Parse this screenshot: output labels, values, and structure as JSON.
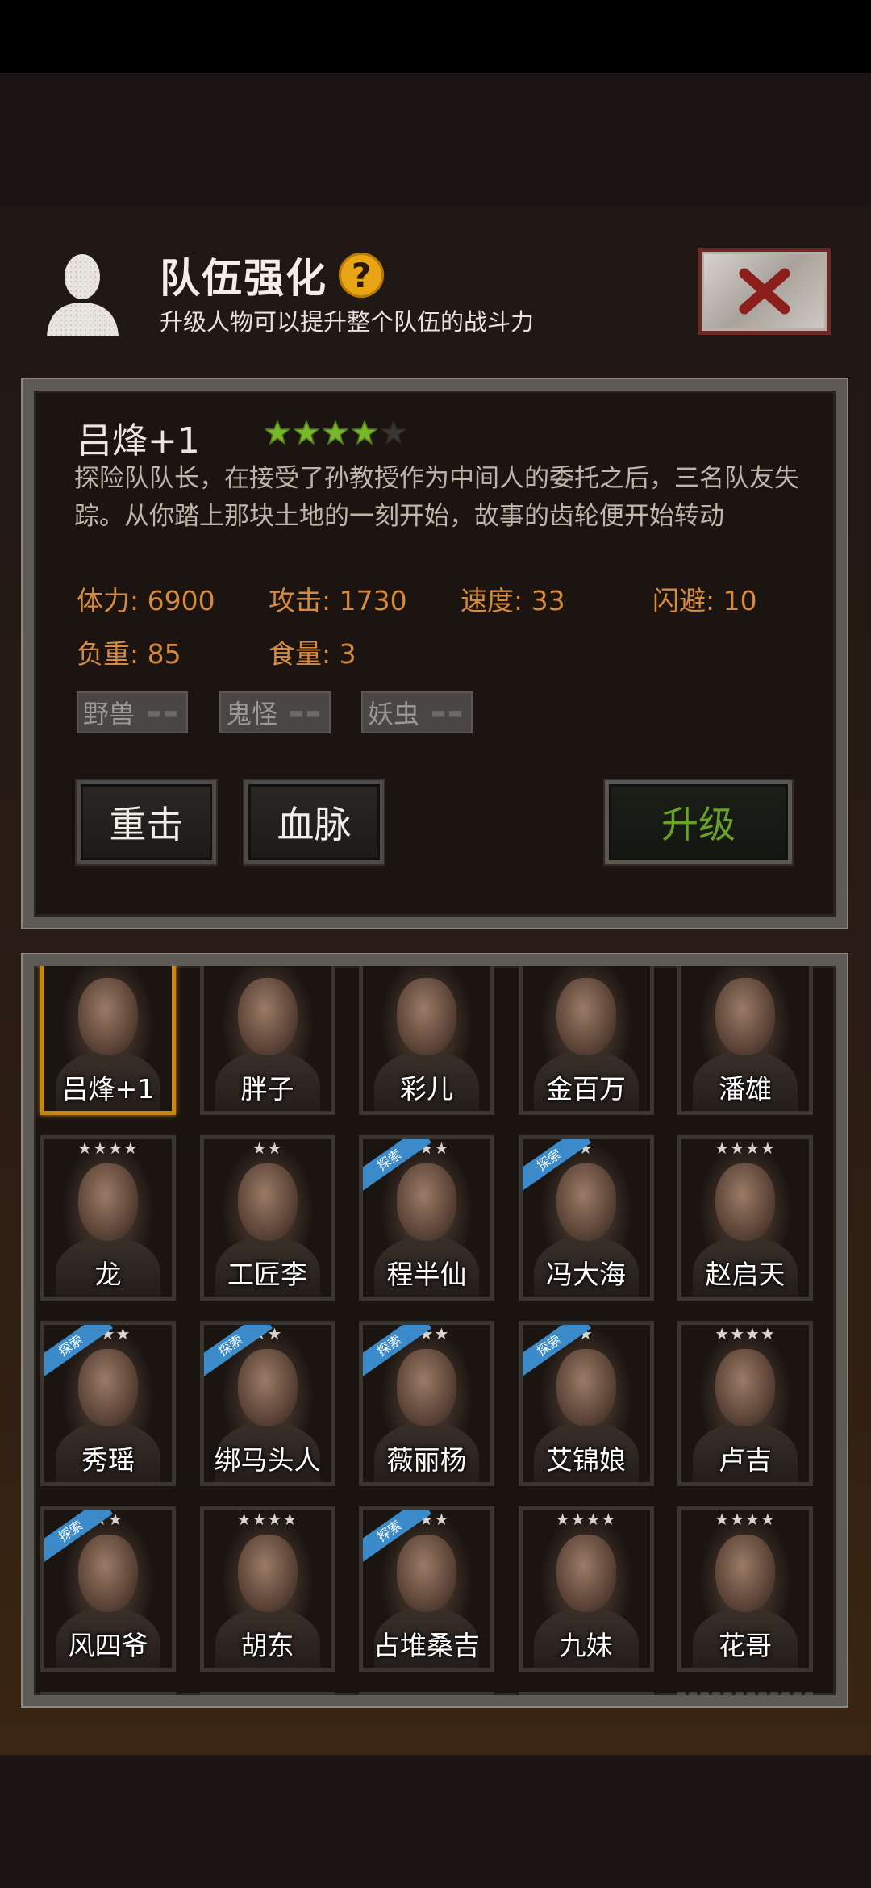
{
  "header": {
    "title": "队伍强化",
    "help_glyph": "?",
    "subtitle": "升级人物可以提升整个队伍的战斗力",
    "icons": [
      "user-silhouette-icon",
      "close-x-icon"
    ]
  },
  "character": {
    "name": "吕烽+1",
    "stars_filled": 4,
    "stars_total": 5,
    "description": "探险队队长，在接受了孙教授作为中间人的委托之后，三名队友失踪。从你踏上那块土地的一刻开始，故事的齿轮便开始转动",
    "stats": {
      "hp": "体力: 6900",
      "attack": "攻击: 1730",
      "speed": "速度: 33",
      "dodge": "闪避: 10",
      "load": "负重: 85",
      "food": "食量: 3"
    },
    "tags": [
      "野兽",
      "鬼怪",
      "妖虫"
    ]
  },
  "buttons": {
    "skill1": "重击",
    "skill2": "血脉",
    "upgrade": "升级"
  },
  "roster": {
    "ribbon_label": "探索",
    "cards": [
      {
        "name": "吕烽+1",
        "stars": "",
        "ribbon": false,
        "selected": true
      },
      {
        "name": "胖子",
        "stars": "",
        "ribbon": false
      },
      {
        "name": "彩儿",
        "stars": "",
        "ribbon": false
      },
      {
        "name": "金百万",
        "stars": "",
        "ribbon": false
      },
      {
        "name": "潘雄",
        "stars": "",
        "ribbon": false
      },
      {
        "name": "龙",
        "stars": "★★★★",
        "ribbon": false
      },
      {
        "name": "工匠李",
        "stars": "★★",
        "ribbon": false
      },
      {
        "name": "程半仙",
        "stars": "★★★",
        "ribbon": true
      },
      {
        "name": "冯大海",
        "stars": "★",
        "ribbon": true
      },
      {
        "name": "赵启天",
        "stars": "★★★★",
        "ribbon": false
      },
      {
        "name": "秀瑶",
        "stars": "★★★",
        "ribbon": true
      },
      {
        "name": "绑马头人",
        "stars": "★★",
        "ribbon": true
      },
      {
        "name": "薇丽杨",
        "stars": "★★★",
        "ribbon": true
      },
      {
        "name": "艾锦娘",
        "stars": "★",
        "ribbon": true
      },
      {
        "name": "卢吉",
        "stars": "★★★★",
        "ribbon": false
      },
      {
        "name": "风四爷",
        "stars": "★★",
        "ribbon": true
      },
      {
        "name": "胡东",
        "stars": "★★★★",
        "ribbon": false
      },
      {
        "name": "占堆桑吉",
        "stars": "★★★",
        "ribbon": true
      },
      {
        "name": "九妹",
        "stars": "★★★★",
        "ribbon": false
      },
      {
        "name": "花哥",
        "stars": "★★★★",
        "ribbon": false
      },
      {
        "name": "",
        "stars": "★★★",
        "ribbon": true
      },
      {
        "name": "",
        "stars": "★★",
        "ribbon": true
      },
      {
        "name": "",
        "stars": "★★★",
        "ribbon": true
      },
      {
        "name": "",
        "stars": "★★★",
        "ribbon": true
      },
      {
        "name": "",
        "stars": "",
        "ribbon": false,
        "empty": true
      }
    ]
  },
  "colors": {
    "stat_text": "#d68a3e",
    "star_green": "#79b82b",
    "upgrade_text": "#6aa129",
    "selected_border": "#c8860a",
    "ribbon": "#3b8ac9"
  }
}
